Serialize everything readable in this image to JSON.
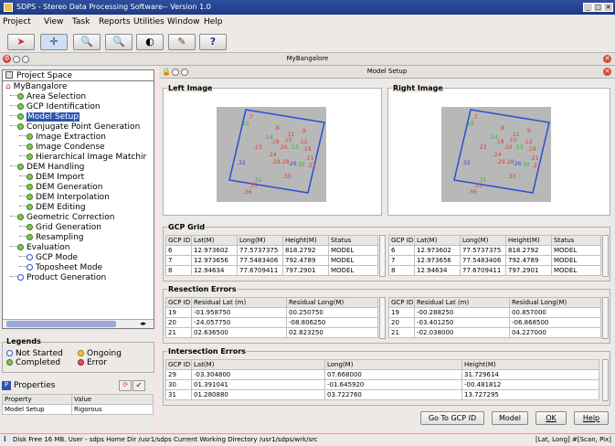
{
  "window": {
    "title": "SDPS - Stereo Data Processing Software-- Version 1.0"
  },
  "menu": [
    "Project",
    "View",
    "Task",
    "Reports",
    "Utilities",
    "Window",
    "Help"
  ],
  "project_bar": {
    "name": "MyBangalore"
  },
  "left_panel": {
    "title": "Project Space",
    "tree": [
      {
        "label": "MyBangalore",
        "level": 0,
        "icon": "home-icon"
      },
      {
        "label": "Area Selection",
        "level": 1
      },
      {
        "label": "GCP Identification",
        "level": 1
      },
      {
        "label": "Model Setup",
        "level": 1,
        "selected": true
      },
      {
        "label": "Conjugate Point Generation",
        "level": 1
      },
      {
        "label": "Image Extraction",
        "level": 2
      },
      {
        "label": "Image Condense",
        "level": 2
      },
      {
        "label": "Hierarchical Image Matchir",
        "level": 2
      },
      {
        "label": "DEM Handling",
        "level": 1
      },
      {
        "label": "DEM Import",
        "level": 2
      },
      {
        "label": "DEM Generation",
        "level": 2
      },
      {
        "label": "DEM Interpolation",
        "level": 2
      },
      {
        "label": "DEM Editing",
        "level": 2
      },
      {
        "label": "Geometric Correction",
        "level": 1
      },
      {
        "label": "Grid Generation",
        "level": 2
      },
      {
        "label": "Resampling",
        "level": 2
      },
      {
        "label": "Evaluation",
        "level": 1
      },
      {
        "label": "GCP Mode",
        "level": 2
      },
      {
        "label": "Toposheet Mode",
        "level": 2
      },
      {
        "label": "Product Generation",
        "level": 1
      }
    ],
    "legend": {
      "title": "Legends",
      "items": [
        "Not Started",
        "Ongoing",
        "Completed",
        "Error"
      ]
    },
    "properties": {
      "title": "Properties",
      "headers": [
        "Property",
        "Value"
      ],
      "rows": [
        [
          "Model Setup",
          "Rigorous"
        ]
      ]
    }
  },
  "model_setup": {
    "title": "Model Setup",
    "left_image": {
      "title": "Left Image",
      "points": [
        {
          "label": "7",
          "color": "#e03a3a"
        },
        {
          "label": "10",
          "color": "#2bb52b"
        },
        {
          "label": "8",
          "color": "#e03a3a"
        },
        {
          "label": "11",
          "color": "#e03a3a"
        },
        {
          "label": "9",
          "color": "#e03a3a"
        },
        {
          "label": "14",
          "color": "#2bb52b"
        },
        {
          "label": "18",
          "color": "#e03a3a"
        },
        {
          "label": "15",
          "color": "#e03a3a"
        },
        {
          "label": "12",
          "color": "#e03a3a"
        },
        {
          "label": "23",
          "color": "#e03a3a"
        },
        {
          "label": "20",
          "color": "#e03a3a"
        },
        {
          "label": "13",
          "color": "#2bb52b"
        },
        {
          "label": "19",
          "color": "#e03a3a"
        },
        {
          "label": "24",
          "color": "#e03a3a"
        },
        {
          "label": "21",
          "color": "#e03a3a"
        },
        {
          "label": "32",
          "color": "#2a4fd6"
        },
        {
          "label": "29",
          "color": "#e03a3a"
        },
        {
          "label": "28",
          "color": "#e03a3a"
        },
        {
          "label": "26",
          "color": "#2a4fd6"
        },
        {
          "label": "30",
          "color": "#2bb52b"
        },
        {
          "label": "27",
          "color": "#e03a3a"
        },
        {
          "label": "33",
          "color": "#e03a3a"
        },
        {
          "label": "31",
          "color": "#2bb52b"
        },
        {
          "label": "35",
          "color": "#e03a3a"
        },
        {
          "label": "36",
          "color": "#e03a3a"
        }
      ]
    },
    "right_image": {
      "title": "Right Image",
      "points": [
        {
          "label": "7",
          "color": "#e03a3a"
        },
        {
          "label": "10",
          "color": "#2bb52b"
        },
        {
          "label": "8",
          "color": "#e03a3a"
        },
        {
          "label": "11",
          "color": "#e03a3a"
        },
        {
          "label": "9",
          "color": "#e03a3a"
        },
        {
          "label": "14",
          "color": "#2bb52b"
        },
        {
          "label": "18",
          "color": "#e03a3a"
        },
        {
          "label": "15",
          "color": "#e03a3a"
        },
        {
          "label": "12",
          "color": "#e03a3a"
        },
        {
          "label": "23",
          "color": "#e03a3a"
        },
        {
          "label": "20",
          "color": "#e03a3a"
        },
        {
          "label": "13",
          "color": "#2bb52b"
        },
        {
          "label": "19",
          "color": "#e03a3a"
        },
        {
          "label": "24",
          "color": "#e03a3a"
        },
        {
          "label": "21",
          "color": "#e03a3a"
        },
        {
          "label": "32",
          "color": "#2a4fd6"
        },
        {
          "label": "29",
          "color": "#e03a3a"
        },
        {
          "label": "28",
          "color": "#e03a3a"
        },
        {
          "label": "26",
          "color": "#2a4fd6"
        },
        {
          "label": "30",
          "color": "#2bb52b"
        },
        {
          "label": "27",
          "color": "#e03a3a"
        },
        {
          "label": "33",
          "color": "#e03a3a"
        },
        {
          "label": "31",
          "color": "#2bb52b"
        },
        {
          "label": "35",
          "color": "#e03a3a"
        },
        {
          "label": "36",
          "color": "#e03a3a"
        }
      ]
    },
    "gcp_grid": {
      "title": "GCP Grid",
      "headers": [
        "GCP ID",
        "Lat(M)",
        "Long(M)",
        "Height(M)",
        "Status"
      ],
      "left_rows": [
        [
          "6",
          "12.973602",
          "77.5737375",
          "818.2792",
          "MODEL"
        ],
        [
          "7",
          "12.973656",
          "77.5483406",
          "792.4789",
          "MODEL"
        ],
        [
          "8",
          "12.94634",
          "77.6709411",
          "797.2901",
          "MODEL"
        ]
      ],
      "right_rows": [
        [
          "6",
          "12.973602",
          "77.5737375",
          "818.2792",
          "MODEL"
        ],
        [
          "7",
          "12.973656",
          "77.5483406",
          "792.4789",
          "MODEL"
        ],
        [
          "8",
          "12.94634",
          "77.6709411",
          "797.2901",
          "MODEL"
        ]
      ]
    },
    "resection_errors": {
      "title": "Resection Errors",
      "headers": [
        "GCP ID",
        "Residual Lat (m)",
        "Residual Long(M)"
      ],
      "left_rows": [
        [
          "19",
          "-01.958750",
          "00.250750"
        ],
        [
          "20",
          "-24.057750",
          "-08.806250"
        ],
        [
          "21",
          "02.636500",
          "02.823250"
        ]
      ],
      "right_rows": [
        [
          "19",
          "-00.288250",
          "00.857000"
        ],
        [
          "20",
          "-03.401250",
          "-06.868500"
        ],
        [
          "21",
          "-02.038000",
          "04.227000"
        ]
      ]
    },
    "intersection_errors": {
      "title": "Intersection Errors",
      "headers": [
        "GCP ID",
        "Lat(M)",
        "Long(M)",
        "Height(M)"
      ],
      "rows": [
        [
          "29",
          "-03.304800",
          "07.668000",
          "31.729614"
        ],
        [
          "30",
          "01.391041",
          "-01.645920",
          "-00.481812"
        ],
        [
          "31",
          "01.280880",
          "03.722760",
          "13.727295"
        ]
      ]
    },
    "buttons": {
      "goto": "Go To GCP ID",
      "model": "Model",
      "ok": "OK",
      "help": "Help"
    }
  },
  "status": {
    "left": "Disk Free 16 MB. User - sdps Home Dir /usr1/sdps Current Working Directory /usr1/sdps/wrk/src",
    "right": "[Lat, Long] #[Scan, Pix]"
  }
}
